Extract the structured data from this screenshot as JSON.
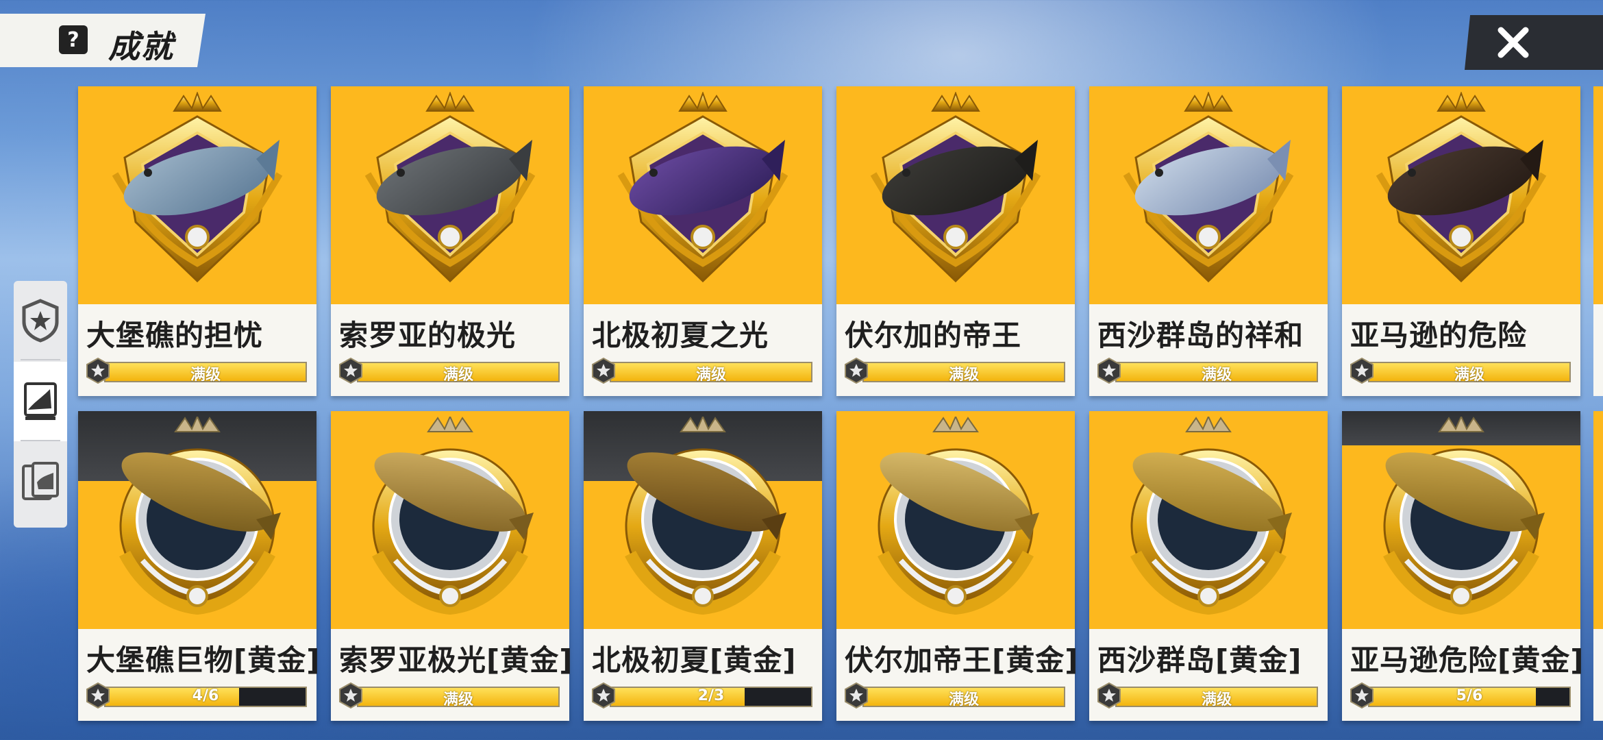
{
  "header": {
    "title": "成就",
    "help_icon": "help-icon"
  },
  "close_icon": "close-icon",
  "side_tabs": [
    {
      "icon": "star-shield-icon",
      "active": false
    },
    {
      "icon": "fish-card-icon",
      "active": true
    },
    {
      "icon": "album-icon",
      "active": false
    }
  ],
  "colors": {
    "card_gold": "#fdb81e",
    "bar_fill": "#f3b40e",
    "bar_bg": "#1d1f24"
  },
  "achievements": [
    {
      "name": "大堡礁的担忧",
      "progress_label": "满级",
      "progress": 1.0,
      "tier": "diamond"
    },
    {
      "name": "索罗亚的极光",
      "progress_label": "满级",
      "progress": 1.0,
      "tier": "diamond"
    },
    {
      "name": "北极初夏之光",
      "progress_label": "满级",
      "progress": 1.0,
      "tier": "diamond"
    },
    {
      "name": "伏尔加的帝王",
      "progress_label": "满级",
      "progress": 1.0,
      "tier": "diamond"
    },
    {
      "name": "西沙群岛的祥和",
      "progress_label": "满级",
      "progress": 1.0,
      "tier": "diamond"
    },
    {
      "name": "亚马逊的危险",
      "progress_label": "满级",
      "progress": 1.0,
      "tier": "diamond"
    },
    {
      "name": "大堡礁巨物[黄金]",
      "progress_label": "4/6",
      "progress": 0.6667,
      "tier": "gold"
    },
    {
      "name": "索罗亚极光[黄金]",
      "progress_label": "满级",
      "progress": 1.0,
      "tier": "gold"
    },
    {
      "name": "北极初夏[黄金]",
      "progress_label": "2/3",
      "progress": 0.6667,
      "tier": "gold"
    },
    {
      "name": "伏尔加帝王[黄金]",
      "progress_label": "满级",
      "progress": 1.0,
      "tier": "gold"
    },
    {
      "name": "西沙群岛[黄金]",
      "progress_label": "满级",
      "progress": 1.0,
      "tier": "gold"
    },
    {
      "name": "亚马逊危险[黄金]",
      "progress_label": "5/6",
      "progress": 0.8333,
      "tier": "gold"
    }
  ]
}
